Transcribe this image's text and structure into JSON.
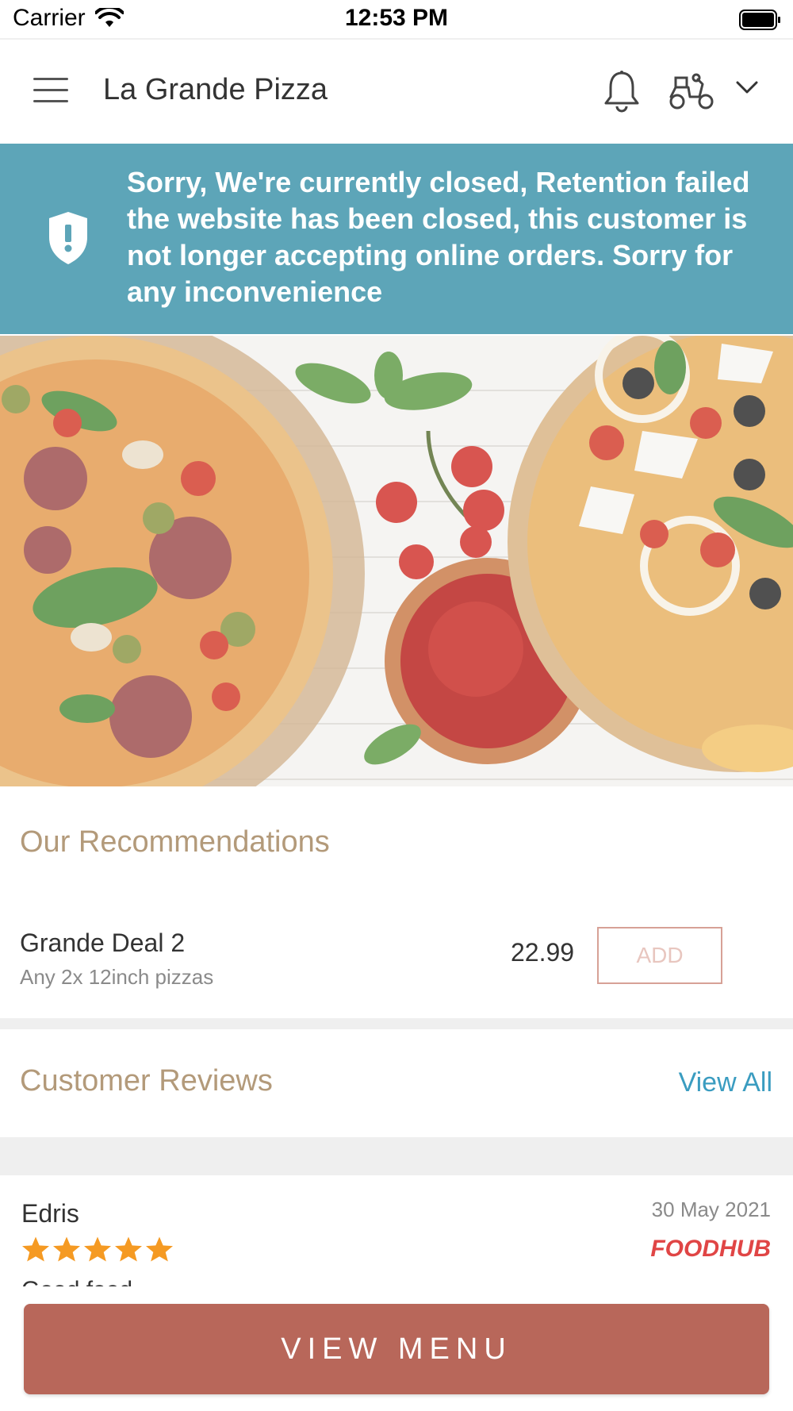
{
  "status_bar": {
    "carrier": "Carrier",
    "time": "12:53 PM"
  },
  "header": {
    "title": "La Grande Pizza"
  },
  "banner": {
    "message": "Sorry, We're currently closed, Retention failed the website has been closed, this customer is not longer accepting online orders. Sorry for any inconvenience"
  },
  "recommendations": {
    "title": "Our Recommendations",
    "items": [
      {
        "name": "Grande Deal 2",
        "description": "Any 2x 12inch pizzas",
        "price": "22.99",
        "add_label": "ADD"
      }
    ]
  },
  "reviews": {
    "title": "Customer Reviews",
    "view_all_label": "View All",
    "items": [
      {
        "name": "Edris",
        "date": "30 May 2021",
        "rating": 5,
        "source": "FOODHUB",
        "text": "Good food"
      }
    ]
  },
  "footer": {
    "view_menu_label": "VIEW MENU"
  },
  "colors": {
    "banner": "#5da5b8",
    "accent": "#b8675a",
    "section_title": "#b39a7a",
    "link": "#3a9cc0",
    "star": "#f59a23"
  }
}
